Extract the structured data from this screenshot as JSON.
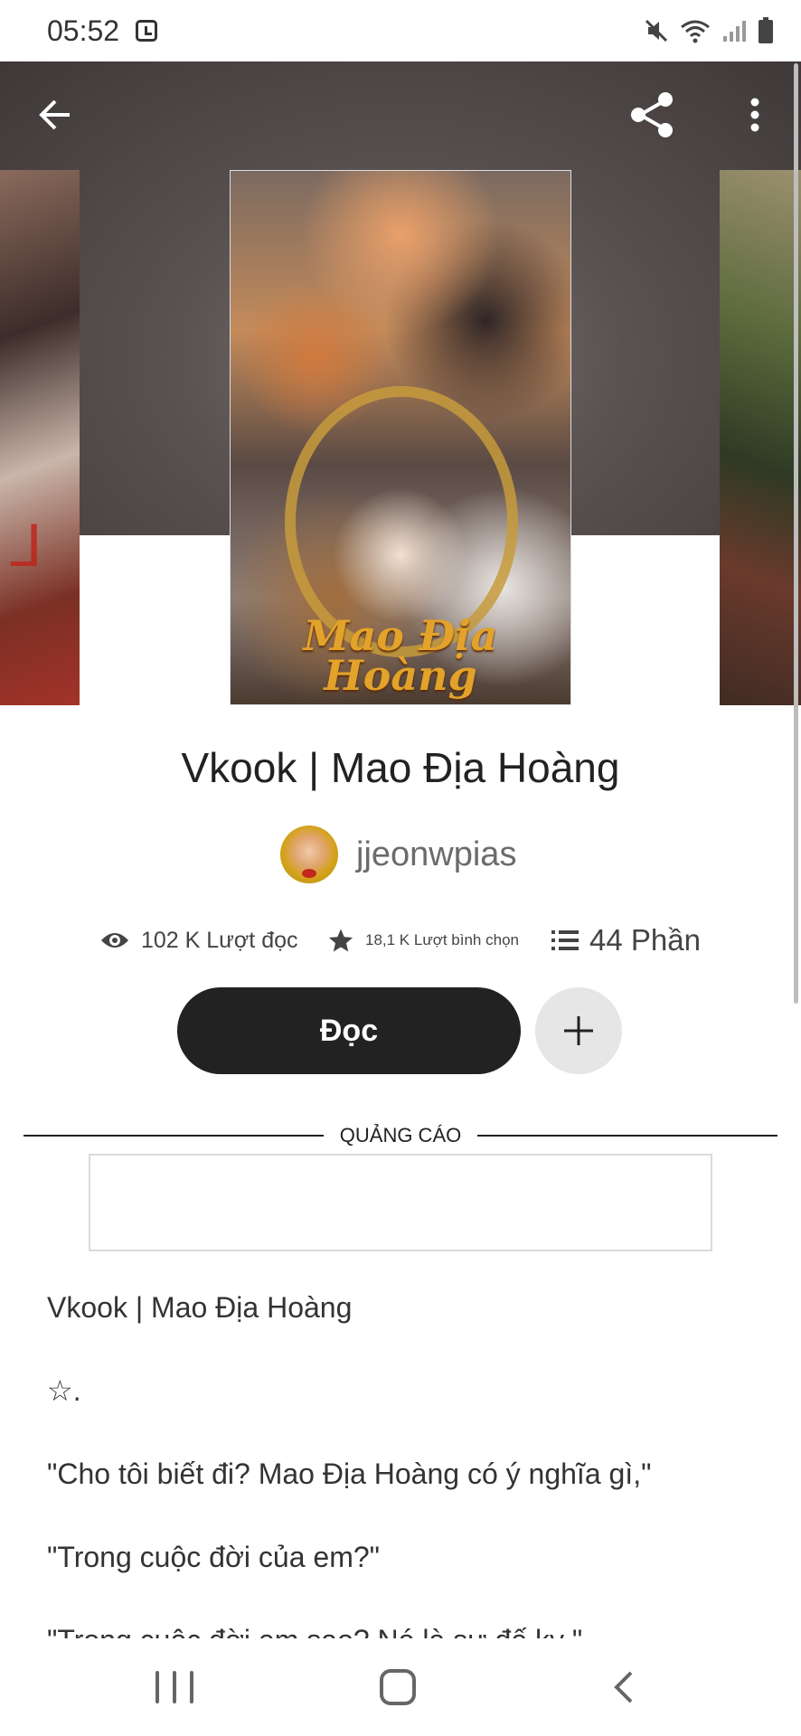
{
  "status_bar": {
    "time": "05:52"
  },
  "story": {
    "title": "Vkook | Mao Địa Hoàng",
    "cover_title": "Mao Địa\nHoàng",
    "author": "jjeonwpias"
  },
  "stats": {
    "reads": "102 K Lượt đọc",
    "votes": "18,1 K Lượt bình chọn",
    "parts": "44 Phần"
  },
  "actions": {
    "read_label": "Đọc"
  },
  "ad": {
    "label": "QUẢNG CÁO"
  },
  "description": [
    "Vkook | Mao Địa Hoàng",
    "☆.",
    "\"Cho tôi biết đi? Mao Địa Hoàng có ý nghĩa gì,\"",
    "\"Trong cuộc đời của em?\"",
    "\"Trong cuộc đời em sao? Nó là sự đế kỵ.\""
  ],
  "colors": {
    "read_button": "#222222",
    "add_button": "#e6e6e6",
    "cover_title": "#e3a22a"
  },
  "icons": [
    "alarm-icon",
    "mute-icon",
    "wifi-icon",
    "signal-icon",
    "battery-icon",
    "back-arrow-icon",
    "share-icon",
    "more-vert-icon",
    "eye-icon",
    "star-icon",
    "list-icon",
    "plus-icon",
    "recents-icon",
    "home-icon",
    "nav-back-icon"
  ]
}
